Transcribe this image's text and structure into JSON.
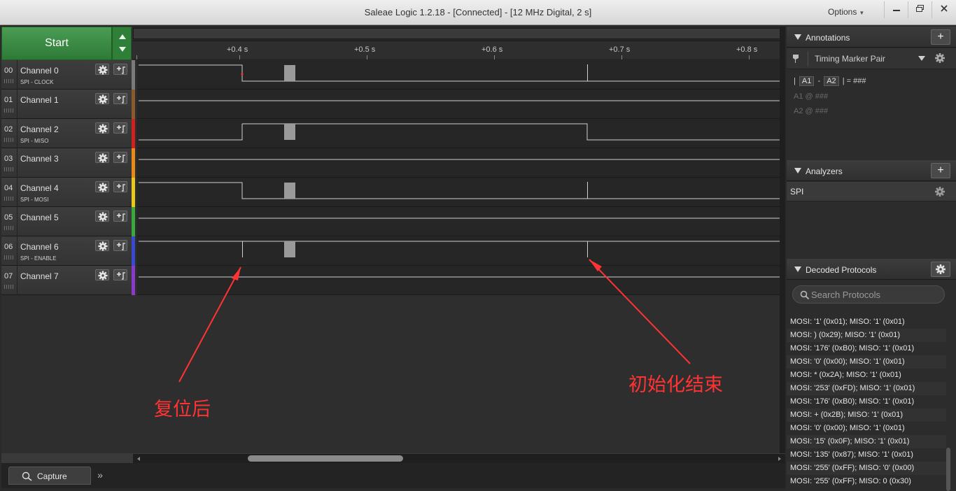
{
  "window": {
    "title": "Saleae Logic 1.2.18 - [Connected] - [12 MHz Digital, 2 s]",
    "options_label": "Options"
  },
  "start_button": {
    "label": "Start"
  },
  "ruler": {
    "ticks": [
      "+0.4 s",
      "+0.5 s",
      "+0.6 s",
      "+0.7 s",
      "+0.8 s"
    ]
  },
  "channels": [
    {
      "num": "00",
      "name": "Channel 0",
      "sub": "SPI - CLOCK",
      "color": "#7a7a7a"
    },
    {
      "num": "01",
      "name": "Channel 1",
      "sub": "",
      "color": "#8b5a2b"
    },
    {
      "num": "02",
      "name": "Channel 2",
      "sub": "SPI - MISO",
      "color": "#d02020"
    },
    {
      "num": "03",
      "name": "Channel 3",
      "sub": "",
      "color": "#e88a1a"
    },
    {
      "num": "04",
      "name": "Channel 4",
      "sub": "SPI - MOSI",
      "color": "#e8c818"
    },
    {
      "num": "05",
      "name": "Channel 5",
      "sub": "",
      "color": "#3aa83a"
    },
    {
      "num": "06",
      "name": "Channel 6",
      "sub": "SPI - ENABLE",
      "color": "#3a4ad0"
    },
    {
      "num": "07",
      "name": "Channel 7",
      "sub": "",
      "color": "#8a3ac8"
    }
  ],
  "annotations": {
    "after_reset": "复位后",
    "init_done": "初始化结束"
  },
  "capture_tab": {
    "label": "Capture"
  },
  "right_panel": {
    "annotations_title": "Annotations",
    "timing_marker_label": "Timing Marker Pair",
    "expr": {
      "a1": "A1",
      "a2": "A2",
      "dash": "-",
      "eq": "= ###"
    },
    "a1_line": "A1  @  ###",
    "a2_line": "A2  @  ###",
    "analyzers_title": "Analyzers",
    "analyzer_name": "SPI",
    "decoded_title": "Decoded Protocols",
    "search_placeholder": "Search Protocols",
    "decoded_items": [
      "MOSI: '1' (0x01);  MISO: '1' (0x01)",
      "MOSI: ) (0x29);  MISO: '1' (0x01)",
      "MOSI: '176' (0xB0);  MISO: '1' (0x01)",
      "MOSI: '0' (0x00);  MISO: '1' (0x01)",
      "MOSI: * (0x2A);  MISO: '1' (0x01)",
      "MOSI: '253' (0xFD);  MISO: '1' (0x01)",
      "MOSI: '176' (0xB0);  MISO: '1' (0x01)",
      "MOSI: + (0x2B);  MISO: '1' (0x01)",
      "MOSI: '0' (0x00);  MISO: '1' (0x01)",
      "MOSI: '15' (0x0F);  MISO: '1' (0x01)",
      "MOSI: '135' (0x87);  MISO: '1' (0x01)",
      "MOSI: '255' (0xFF);  MISO: '0' (0x00)",
      "MOSI: '255' (0xFF);  MISO: 0 (0x30)"
    ]
  }
}
